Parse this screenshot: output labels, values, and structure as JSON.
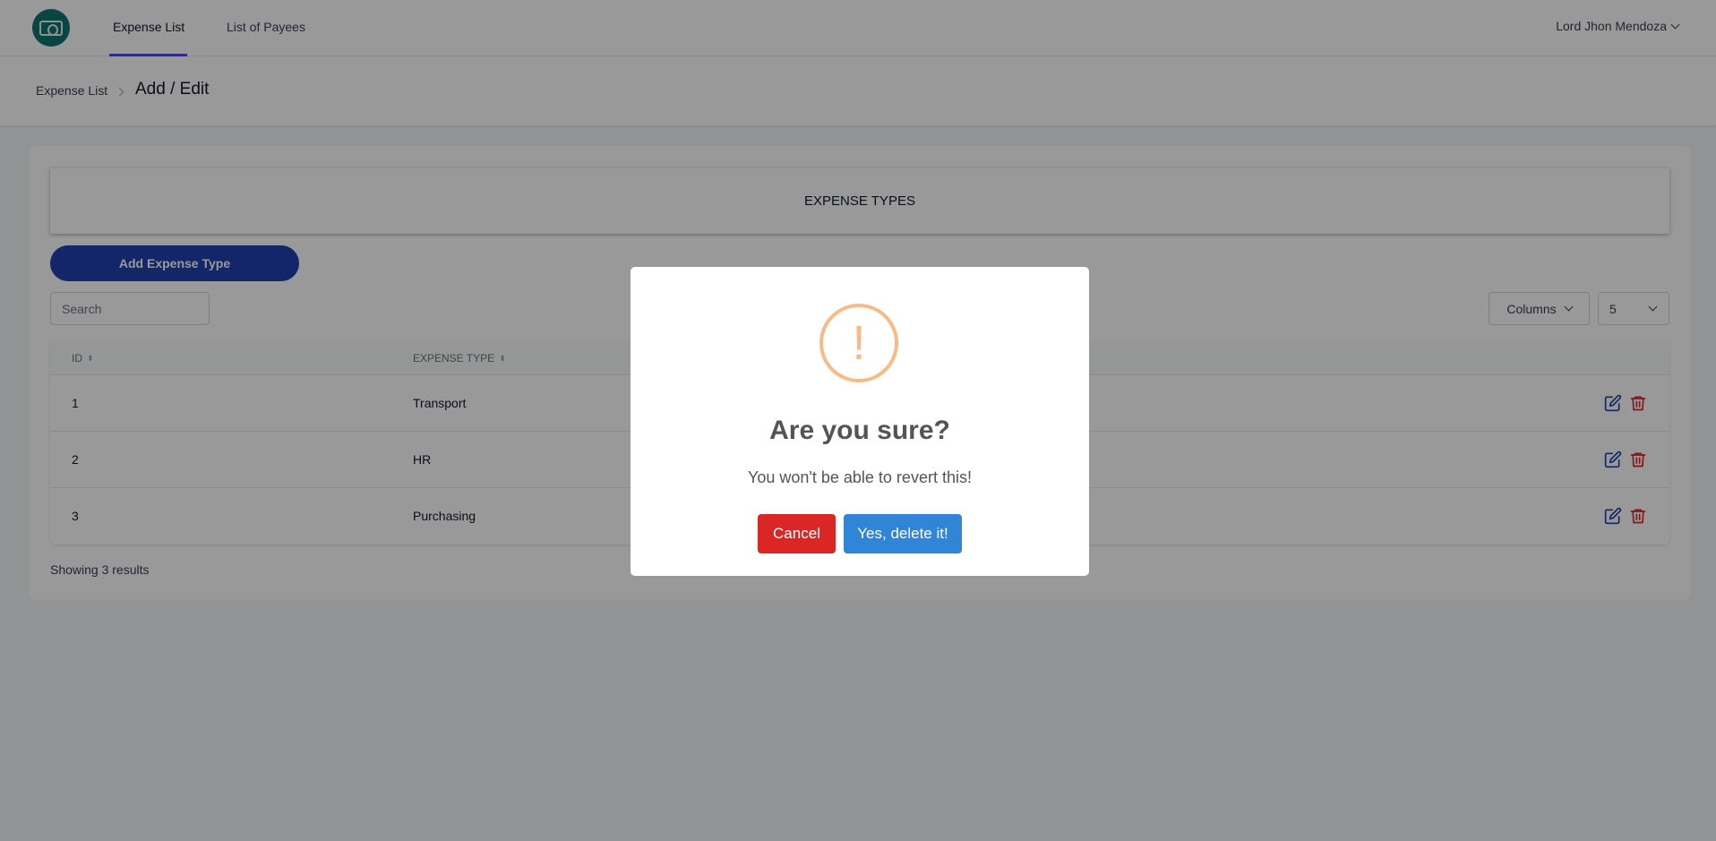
{
  "nav": {
    "tabs": [
      {
        "label": "Expense List"
      },
      {
        "label": "List of Payees"
      }
    ],
    "user_name": "Lord Jhon Mendoza",
    "logo_icon": "money-bill-icon"
  },
  "breadcrumb": {
    "parent": "Expense List",
    "current": "Add / Edit"
  },
  "section": {
    "title": "EXPENSE TYPES",
    "add_button": "Add Expense Type"
  },
  "search": {
    "placeholder": "Search",
    "value": ""
  },
  "columns_button": "Columns",
  "per_page": "5",
  "table": {
    "headers": [
      "ID",
      "EXPENSE TYPE"
    ],
    "rows": [
      {
        "id": "1",
        "type": "Transport"
      },
      {
        "id": "2",
        "type": "HR"
      },
      {
        "id": "3",
        "type": "Purchasing"
      }
    ]
  },
  "footer": {
    "showing": "Showing 3 results"
  },
  "dialog": {
    "icon": "!",
    "title": "Are you sure?",
    "text": "You won't be able to revert this!",
    "cancel": "Cancel",
    "confirm": "Yes, delete it!"
  },
  "colors": {
    "primary": "#1e40af",
    "danger": "#dc2626",
    "confirm": "#3085d6",
    "warning": "#f8bb86",
    "logo": "#0f766e"
  }
}
